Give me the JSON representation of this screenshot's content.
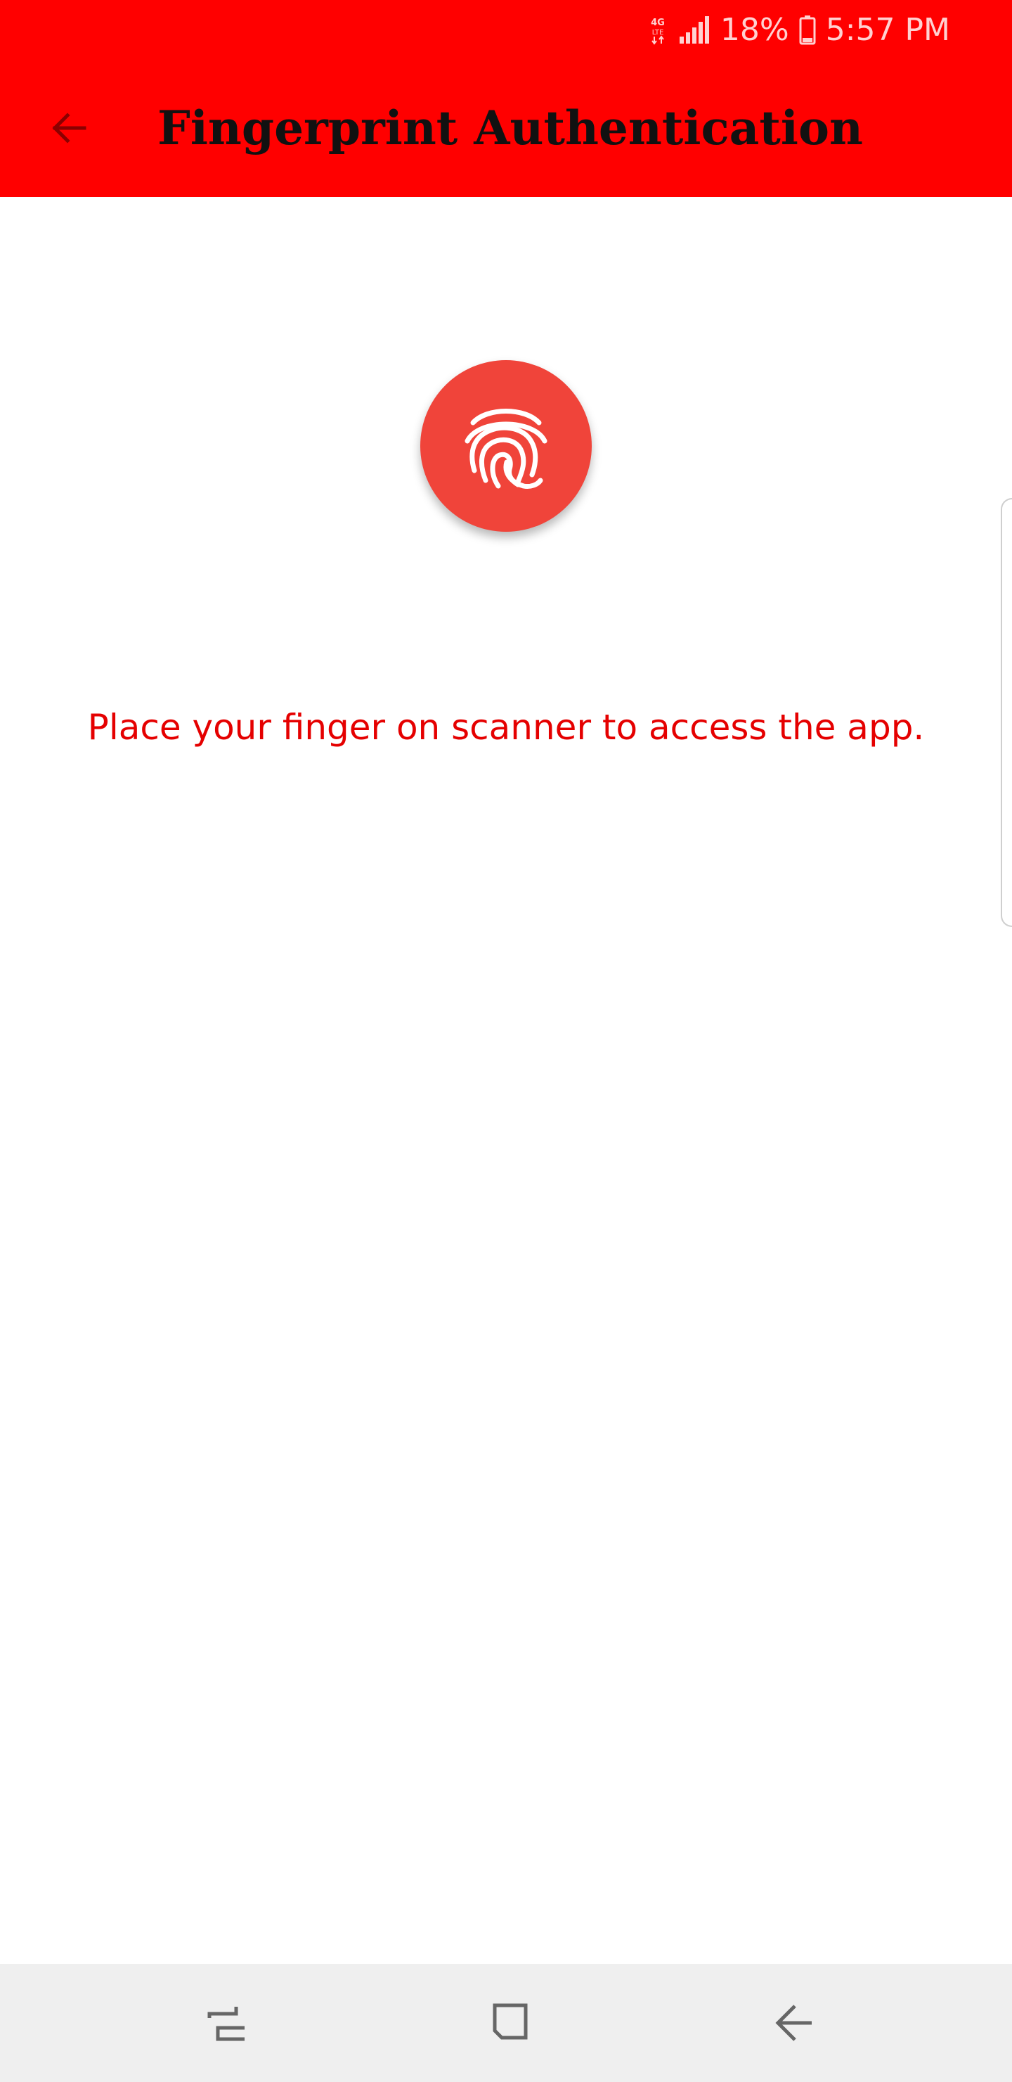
{
  "status_bar": {
    "network": "4G LTE",
    "battery_percent": "18%",
    "time": "5:57 PM",
    "icons": [
      "network-4g-icon",
      "signal-icon",
      "battery-icon"
    ]
  },
  "toolbar": {
    "title": "Fingerprint Authentication",
    "back_icon": "arrow-left-icon",
    "background": "#ff0000"
  },
  "main": {
    "fingerprint_icon": "fingerprint-icon",
    "fingerprint_color": "#f0443a",
    "message": "Place your finger on scanner to access the app.",
    "message_color": "#e50000"
  },
  "nav_bar": {
    "items": [
      "recent-apps-icon",
      "home-icon",
      "back-icon"
    ]
  }
}
